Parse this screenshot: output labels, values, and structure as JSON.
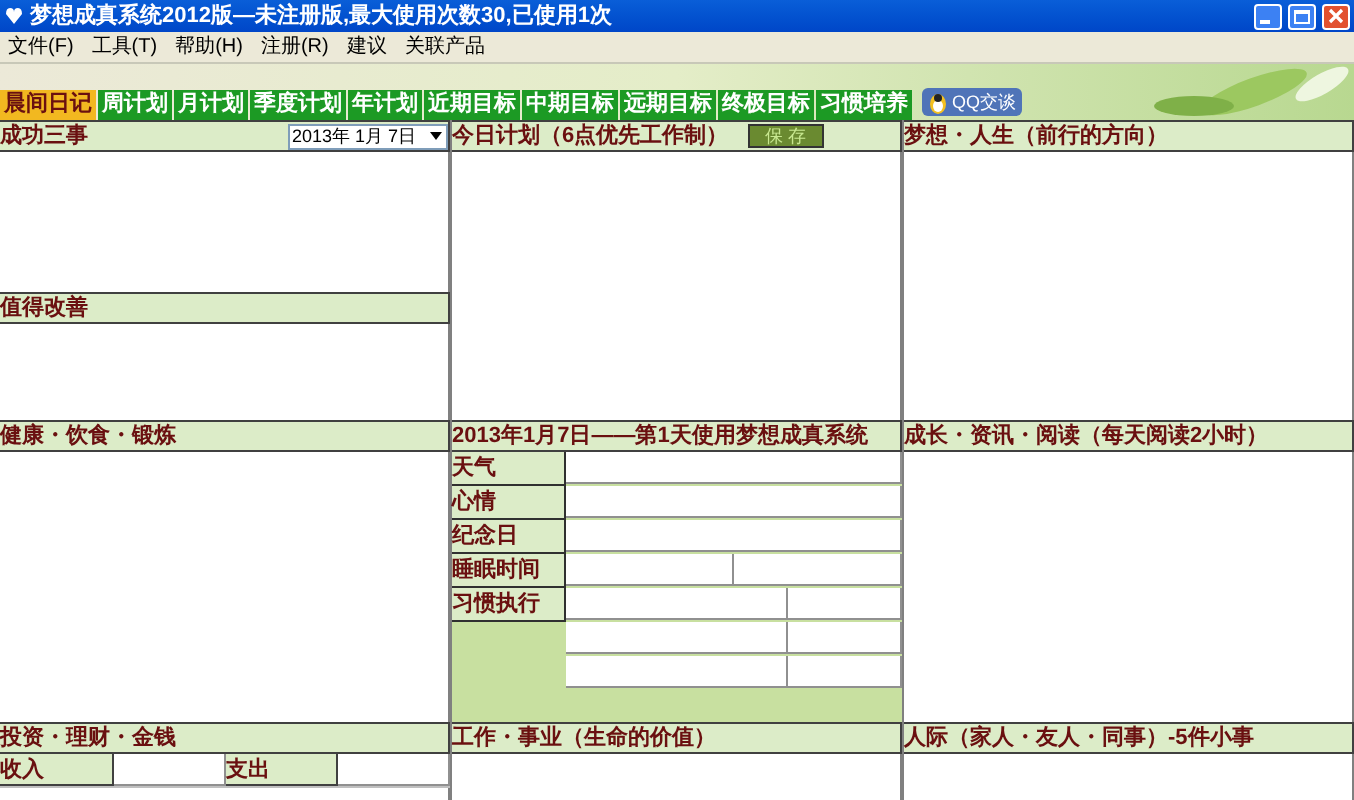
{
  "window": {
    "title": "梦想成真系统2012版—未注册版,最大使用次数30,已使用1次"
  },
  "menu": [
    "文件(F)",
    "工具(T)",
    "帮助(H)",
    "注册(R)",
    "建议",
    "关联产品"
  ],
  "tabs": [
    {
      "label": "晨间日记",
      "selected": true
    },
    {
      "label": "周计划",
      "selected": false
    },
    {
      "label": "月计划",
      "selected": false
    },
    {
      "label": "季度计划",
      "selected": false
    },
    {
      "label": "年计划",
      "selected": false
    },
    {
      "label": "近期目标",
      "selected": false
    },
    {
      "label": "中期目标",
      "selected": false
    },
    {
      "label": "远期目标",
      "selected": false
    },
    {
      "label": "终极目标",
      "selected": false
    },
    {
      "label": "习惯培养",
      "selected": false
    }
  ],
  "chat_button": {
    "label": "QQ交谈"
  },
  "column_1": {
    "success": {
      "title": "成功三事",
      "date": "2013年 1月 7日"
    },
    "improve": {
      "title": "值得改善"
    },
    "health": {
      "title": "健康・饮食・锻炼"
    },
    "money": {
      "title": "投资・理财・金钱",
      "income_label": "收入",
      "expense_label": "支出"
    }
  },
  "column_2": {
    "plan": {
      "title": "今日计划（6点优先工作制）",
      "save_button": "保 存"
    },
    "diary": {
      "title": "2013年1月7日——第1天使用梦想成真系统",
      "rows": [
        {
          "label": "天气",
          "kind": "single"
        },
        {
          "label": "心情",
          "kind": "single"
        },
        {
          "label": "纪念日",
          "kind": "single"
        },
        {
          "label": "睡眠时间",
          "kind": "half"
        },
        {
          "label": "习惯执行",
          "kind": "split"
        },
        {
          "kind": "split"
        },
        {
          "kind": "split"
        }
      ]
    },
    "work": {
      "title": "工作・事业（生命的价值）"
    }
  },
  "column_3": {
    "dream": {
      "title": "梦想・人生（前行的方向）"
    },
    "growth": {
      "title": "成长・资讯・阅读（每天阅读2小时）"
    },
    "people": {
      "title": "人际（家人・友人・同事）-5件小事"
    }
  }
}
